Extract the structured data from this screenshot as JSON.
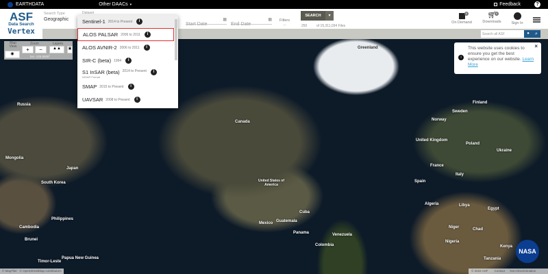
{
  "topbar": {
    "earthdata": "EARTHDATA",
    "other_daacs": "Other DAACs",
    "feedback": "Feedback",
    "help": "?"
  },
  "logo": {
    "asf": "ASF",
    "data_search": "Data Search",
    "vertex": "Vertex"
  },
  "search_type": {
    "label": "Search Type",
    "value": "Geographic"
  },
  "dataset": {
    "label": "Dataset"
  },
  "dates": {
    "start": "Start Date",
    "end": "End Date"
  },
  "filters": {
    "label": "Filters",
    "dots": "..."
  },
  "search": {
    "label": "SEARCH",
    "count": "250",
    "of_files": "of 15,311,034 Files"
  },
  "header_icons": {
    "on_demand": "On Demand",
    "on_demand_badge": "0",
    "downloads": "Downloads",
    "downloads_badge": "0",
    "sign_in": "Sign In"
  },
  "site_search": {
    "placeholder": "Search all ASF"
  },
  "map_controls": {
    "map_view": "Map View",
    "zoom": "Zoom",
    "zoom_in": "+",
    "zoom_out": "−",
    "layers": "Layers",
    "coords": "lon -125.5506°"
  },
  "datasets": [
    {
      "name": "Sentinel-1",
      "years": "2014 to Present"
    },
    {
      "name": "ALOS PALSAR",
      "years": "2006 to 2011"
    },
    {
      "name": "ALOS AVNIR-2",
      "years": "2006 to 2011"
    },
    {
      "name": "SIR-C (beta)",
      "years": "1994"
    },
    {
      "name": "S1 InSAR (beta)",
      "years": "2014 to Present",
      "sub": "NISAR Format"
    },
    {
      "name": "SMAP",
      "years": "2015 to Present"
    },
    {
      "name": "UAVSAR",
      "years": "2008 to Present"
    }
  ],
  "cookie": {
    "text": "This website uses cookies to ensure you get the best experience on our website.",
    "link": "Learn More",
    "close": "×"
  },
  "footer": {
    "attribution": "© MapTiler   © OpenStreetMap contributors",
    "copyright": "© 2022 ASF",
    "contact": "Contact",
    "nondiscrimination": "Non-Discrimination",
    "nasa": "NASA"
  },
  "colors": {
    "accent": "#1f5a8a",
    "selected_border": "#e0302b",
    "search_btn": "#5a5a50"
  },
  "places": [
    {
      "name": "Greenland"
    },
    {
      "name": "Canada"
    },
    {
      "name": "United States of America"
    },
    {
      "name": "Mexico"
    },
    {
      "name": "Cuba"
    },
    {
      "name": "Guatemala"
    },
    {
      "name": "Panama"
    },
    {
      "name": "Venezuela"
    },
    {
      "name": "Colombia"
    },
    {
      "name": "Russia"
    },
    {
      "name": "Mongolia"
    },
    {
      "name": "Japan"
    },
    {
      "name": "South Korea"
    },
    {
      "name": "Philippines"
    },
    {
      "name": "Cambodia"
    },
    {
      "name": "Brunei"
    },
    {
      "name": "Timor-Leste"
    },
    {
      "name": "Papua New Guinea"
    },
    {
      "name": "Sweden"
    },
    {
      "name": "Norway"
    },
    {
      "name": "Finland"
    },
    {
      "name": "United Kingdom"
    },
    {
      "name": "Poland"
    },
    {
      "name": "Ukraine"
    },
    {
      "name": "France"
    },
    {
      "name": "Spain"
    },
    {
      "name": "Italy"
    },
    {
      "name": "Algeria"
    },
    {
      "name": "Libya"
    },
    {
      "name": "Egypt"
    },
    {
      "name": "Niger"
    },
    {
      "name": "Chad"
    },
    {
      "name": "Nigeria"
    },
    {
      "name": "Kenya"
    },
    {
      "name": "Tanzania"
    }
  ]
}
